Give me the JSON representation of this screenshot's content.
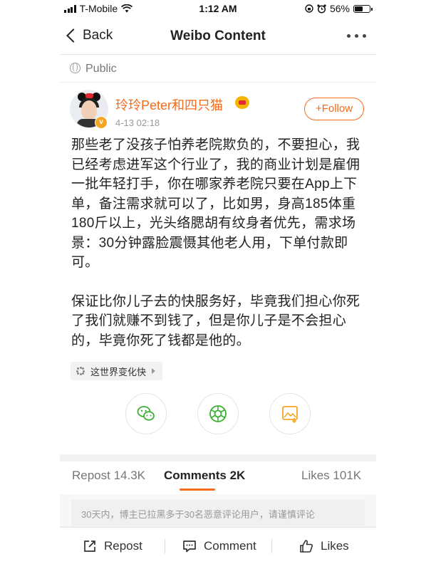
{
  "status_bar": {
    "carrier": "T-Mobile",
    "time": "1:12 AM",
    "battery": "56%",
    "battery_level": 0.56
  },
  "nav": {
    "back_label": "Back",
    "title": "Weibo Content"
  },
  "visibility": {
    "label": "Public"
  },
  "post": {
    "username": "玲玲Peter和四只猫",
    "verified_badge": "v",
    "timestamp": "4-13 02:18",
    "follow_label": "+Follow",
    "paragraphs": [
      "那些老了没孩子怕养老院欺负的，不要担心，我已经考虑进军这个行业了，我的商业计划是雇佣一批年轻打手，你在哪家养老院只要在App上下单，备注需求就可以了，比如男，身高185体重180斤以上，光头络腮胡有纹身者优先，需求场景：30分钟露脸震慑其他老人用，下单付款即可。",
      "保证比你儿子去的快服务好，毕竟我们担心你死了我们就赚不到钱了，但是你儿子是不会担心的，毕竟你死了钱都是他的。"
    ],
    "topic": "这世界变化快"
  },
  "share_icons": [
    "wechat-icon",
    "moments-icon",
    "save-image-icon"
  ],
  "colors": {
    "accent": "#f46b1b",
    "share_green": "#3cb034",
    "share_orange": "#f5a623"
  },
  "tabs": {
    "repost": "Repost 14.3K",
    "comments": "Comments 2K",
    "likes": "Likes 101K",
    "active": "comments"
  },
  "notice": "30天内，博主已拉黑多于30名恶意评论用户，请谨慎评论",
  "bottom_bar": {
    "repost": "Repost",
    "comment": "Comment",
    "likes": "Likes"
  }
}
